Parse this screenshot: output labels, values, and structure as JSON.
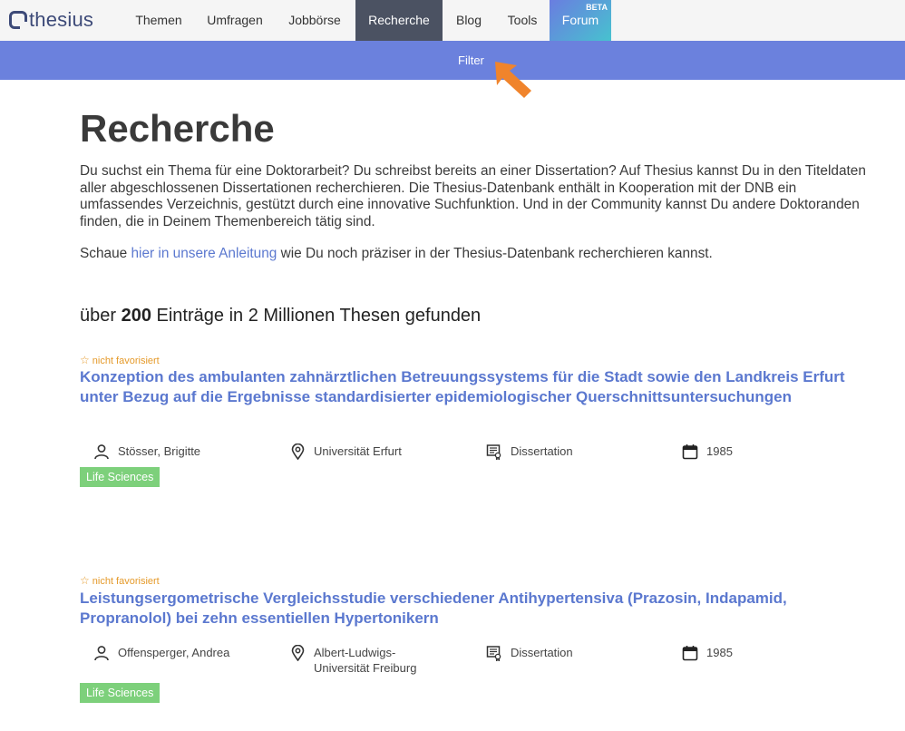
{
  "brand": {
    "name": "thesius"
  },
  "nav": {
    "items": [
      {
        "label": "Themen"
      },
      {
        "label": "Umfragen"
      },
      {
        "label": "Jobbörse"
      },
      {
        "label": "Recherche"
      },
      {
        "label": "Blog"
      },
      {
        "label": "Tools"
      },
      {
        "label": "Forum",
        "badge": "BETA"
      }
    ],
    "active": "Recherche"
  },
  "filterbar": {
    "label": "Filter"
  },
  "page": {
    "title": "Recherche",
    "intro": "Du suchst ein Thema für eine Doktorarbeit? Du schreibst bereits an einer Dissertation? Auf Thesius kannst Du in den Titeldaten aller abgeschlossenen Dissertationen recherchieren. Die Thesius-Datenbank enthält in Kooperation mit der DNB ein umfassendes Verzeichnis, gestützt durch eine innovative Suchfunktion. Und in der Community kannst Du andere Doktoranden finden, die in Deinem Themenbereich tätig sind.",
    "howto_before": "Schaue ",
    "howto_link": "hier in unsere Anleitung",
    "howto_after": " wie Du noch präziser in der Thesius-Datenbank recherchieren kannst."
  },
  "results": {
    "count_prefix": "über ",
    "count_value": "200",
    "count_suffix": " Einträge in 2 Millionen Thesen gefunden",
    "items": [
      {
        "favorite": "nicht favorisiert",
        "title": "Konzeption des ambulanten zahnärztlichen Betreuungssystems für die Stadt sowie den Landkreis Erfurt unter Bezug auf die Ergebnisse standardisierter epidemiologischer Querschnittsuntersuchungen",
        "author": "Stösser, Brigitte",
        "university": "Universität Erfurt",
        "type": "Dissertation",
        "year": "1985",
        "tag": "Life Sciences"
      },
      {
        "favorite": "nicht favorisiert",
        "title": "Leistungsergometrische Vergleichsstudie verschiedener Antihypertensiva (Prazosin, Indapamid, Propranolol) bei zehn essentiellen Hypertonikern",
        "author": "Offensperger, Andrea",
        "university": "Albert-Ludwigs-Universität Freiburg",
        "type": "Dissertation",
        "year": "1985",
        "tag": "Life Sciences"
      }
    ]
  },
  "colors": {
    "nav_active": "#4b5262",
    "filterbar": "#6b81dd",
    "link": "#5b78cf",
    "tag": "#7dd07b",
    "favorite": "#e59a2a",
    "arrow": "#f0842c"
  },
  "icons": [
    "user-icon",
    "location-icon",
    "document-icon",
    "calendar-icon",
    "star-icon",
    "arrow-icon"
  ]
}
